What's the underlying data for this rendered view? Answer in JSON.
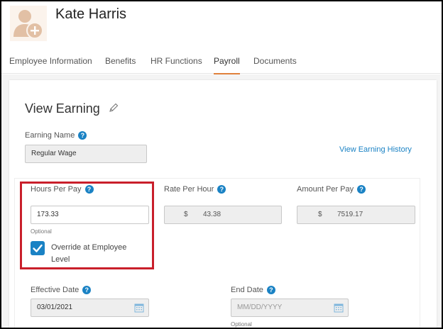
{
  "employee": {
    "name": "Kate Harris"
  },
  "tabs": [
    {
      "label": "Employee Information"
    },
    {
      "label": "Benefits"
    },
    {
      "label": "HR Functions"
    },
    {
      "label": "Payroll",
      "active": true
    },
    {
      "label": "Documents"
    }
  ],
  "page": {
    "title": "View Earning",
    "history_link": "View Earning History"
  },
  "earning_name": {
    "label": "Earning Name",
    "value": "Regular Wage"
  },
  "hours_per_pay": {
    "label": "Hours Per Pay",
    "value": "173.33",
    "hint": "Optional"
  },
  "override": {
    "label": "Override at Employee Level",
    "checked": true
  },
  "rate_per_hour": {
    "label": "Rate Per Hour",
    "currency": "$",
    "value": "43.38"
  },
  "amount_per_pay": {
    "label": "Amount Per Pay",
    "currency": "$",
    "value": "7519.17"
  },
  "effective_date": {
    "label": "Effective Date",
    "value": "03/01/2021"
  },
  "end_date": {
    "label": "End Date",
    "placeholder": "MM/DD/YYYY",
    "hint": "Optional"
  },
  "colors": {
    "accent_blue": "#1a82c4",
    "active_tab_underline": "#e0813c",
    "highlight_red": "#c91f2b",
    "avatar_tan": "#e2c0a5"
  },
  "icons": {
    "help": "help-icon",
    "edit": "pencil-icon",
    "calendar": "calendar-icon",
    "avatar": "add-user-avatar-icon"
  }
}
